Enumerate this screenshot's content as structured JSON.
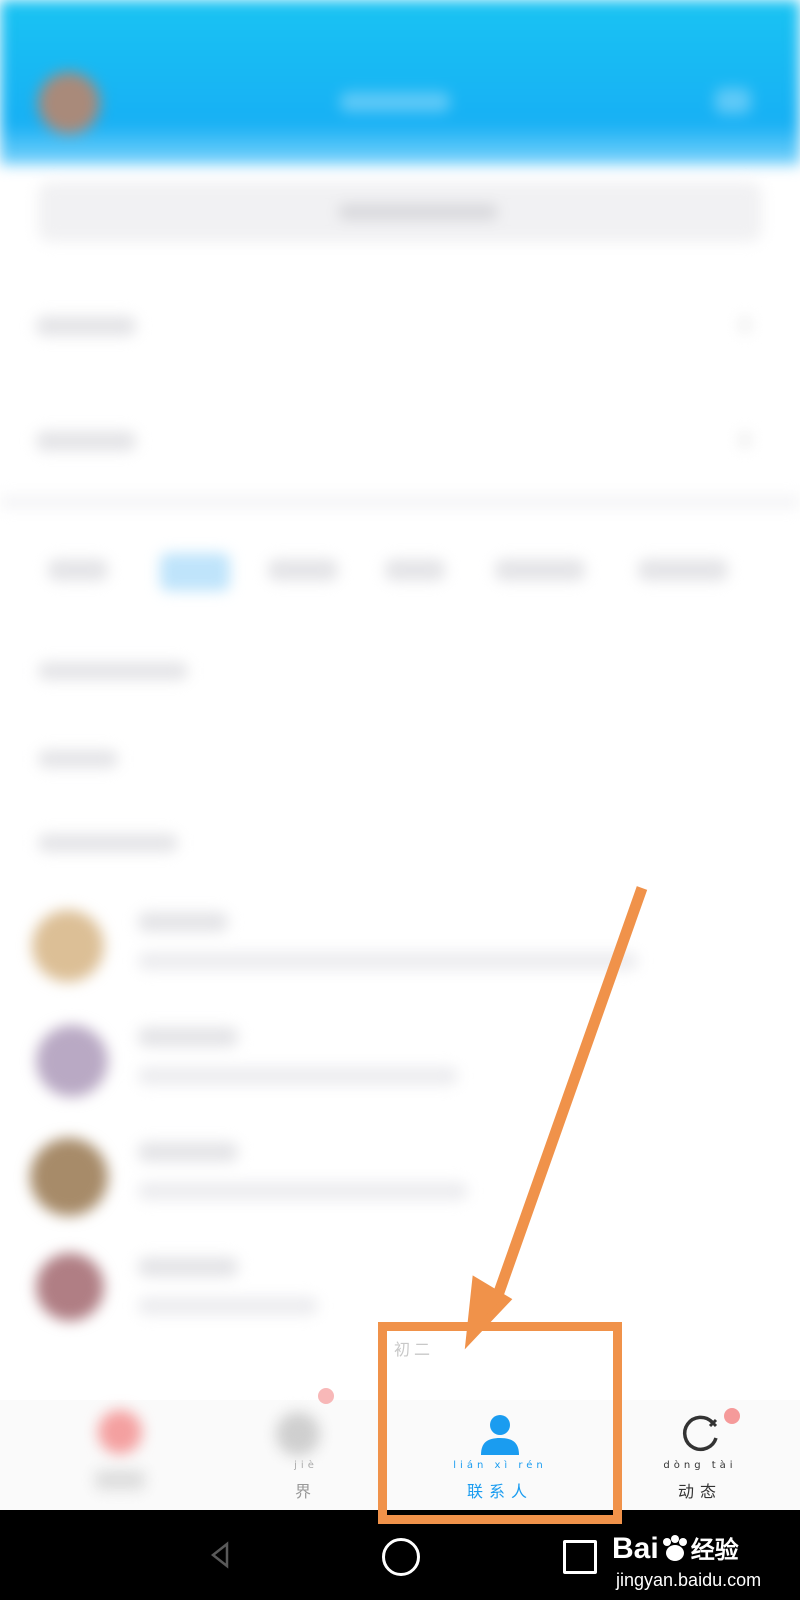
{
  "tabbar": {
    "contacts": {
      "pinyin": "lián xì rén",
      "label": "联系人"
    },
    "trends": {
      "pinyin": "dòng tài",
      "label": "动态"
    },
    "world_partial": {
      "pinyin": "jiè",
      "label": "界"
    }
  },
  "partial_text": "初二",
  "watermark": {
    "brand": "Bai",
    "brand_suffix": "经验",
    "url": "jingyan.baidu.com"
  },
  "colors": {
    "header": "#17b0f4",
    "accent": "#1a9cf0",
    "annotation": "#f0924a",
    "badge": "#f59a9a"
  }
}
